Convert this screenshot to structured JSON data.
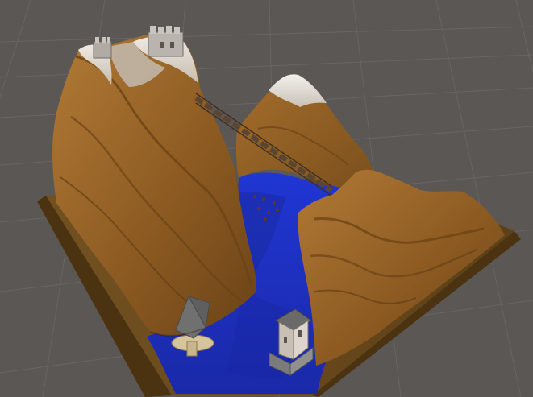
{
  "scene": {
    "view": "perspective",
    "grid": true,
    "colors": {
      "background": "#5b5755",
      "grid_line": "#6d6967",
      "terrain_light": "#a9712e",
      "terrain_mid": "#8a5a22",
      "terrain_dark": "#5b3b14",
      "snow": "#e9e7e3",
      "water": "#1f2fbf",
      "water_dark": "#18269a",
      "base": "#6a4617"
    },
    "objects": [
      {
        "name": "castle-left",
        "icon": "castle-icon"
      },
      {
        "name": "snow-peak-right",
        "icon": "mountain-icon"
      },
      {
        "name": "rope-bridge",
        "icon": "bridge-icon"
      },
      {
        "name": "house-left",
        "icon": "house-icon"
      },
      {
        "name": "tower-right",
        "icon": "tower-icon"
      }
    ]
  }
}
